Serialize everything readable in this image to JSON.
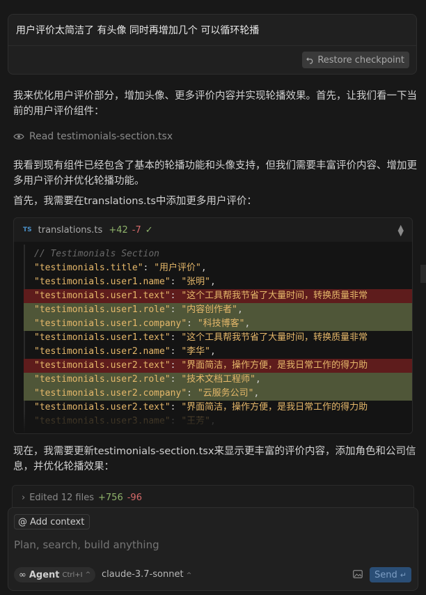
{
  "user_message": {
    "text": "用户评价太简洁了 有头像 同时再增加几个 可以循环轮播",
    "restore_label": "Restore checkpoint"
  },
  "assistant": {
    "para1": "我来优化用户评价部分，增加头像、更多评价内容并实现轮播效果。首先，让我们看一下当前的用户评价组件：",
    "read_label": "Read testimonials-section.tsx",
    "para2": "我看到现有组件已经包含了基本的轮播功能和头像支持，但我们需要丰富评价内容、增加更多用户评价并优化轮播功能。",
    "para3": "首先，我需要在translations.ts中添加更多用户评价：",
    "para4": "现在，我需要更新testimonials-section.tsx来显示更丰富的评价内容，添加角色和公司信息，并优化轮播效果："
  },
  "code_block": {
    "badge": "TS",
    "filename": "translations.ts",
    "additions": "+42",
    "deletions": "-7",
    "lines": [
      {
        "type": "comment",
        "key": "// Testimonials Section",
        "value": ""
      },
      {
        "type": "normal",
        "key": "\"testimonials.title\"",
        "value": "\"用户评价\""
      },
      {
        "type": "normal",
        "key": "\"testimonials.user1.name\"",
        "value": "\"张明\""
      },
      {
        "type": "del",
        "key": "\"testimonials.user1.text\"",
        "value": "\"这个工具帮我节省了大量时间，转换质量非常"
      },
      {
        "type": "add",
        "key": "\"testimonials.user1.role\"",
        "value": "\"内容创作者\""
      },
      {
        "type": "add",
        "key": "\"testimonials.user1.company\"",
        "value": "\"科技博客\""
      },
      {
        "type": "normal",
        "key": "\"testimonials.user1.text\"",
        "value": "\"这个工具帮我节省了大量时间，转换质量非常"
      },
      {
        "type": "normal",
        "key": "\"testimonials.user2.name\"",
        "value": "\"李华\""
      },
      {
        "type": "del",
        "key": "\"testimonials.user2.text\"",
        "value": "\"界面简洁，操作方便，是我日常工作的得力助"
      },
      {
        "type": "add",
        "key": "\"testimonials.user2.role\"",
        "value": "\"技术文档工程师\""
      },
      {
        "type": "add",
        "key": "\"testimonials.user2.company\"",
        "value": "\"云服务公司\""
      },
      {
        "type": "normal",
        "key": "\"testimonials.user2.text\"",
        "value": "\"界面简洁，操作方便，是我日常工作的得力助"
      },
      {
        "type": "faded",
        "key": "\"testimonials.user3.name\"",
        "value": "\"王芳\""
      }
    ]
  },
  "edited_files": {
    "label": "Edited 12 files",
    "additions": "+756",
    "deletions": "-96"
  },
  "composer": {
    "add_context_label": "Add context",
    "placeholder": "Plan, search, build anything",
    "agent_label": "Agent",
    "agent_shortcut": "Ctrl+I",
    "model": "claude-3.7-sonnet",
    "send_label": "Send"
  }
}
